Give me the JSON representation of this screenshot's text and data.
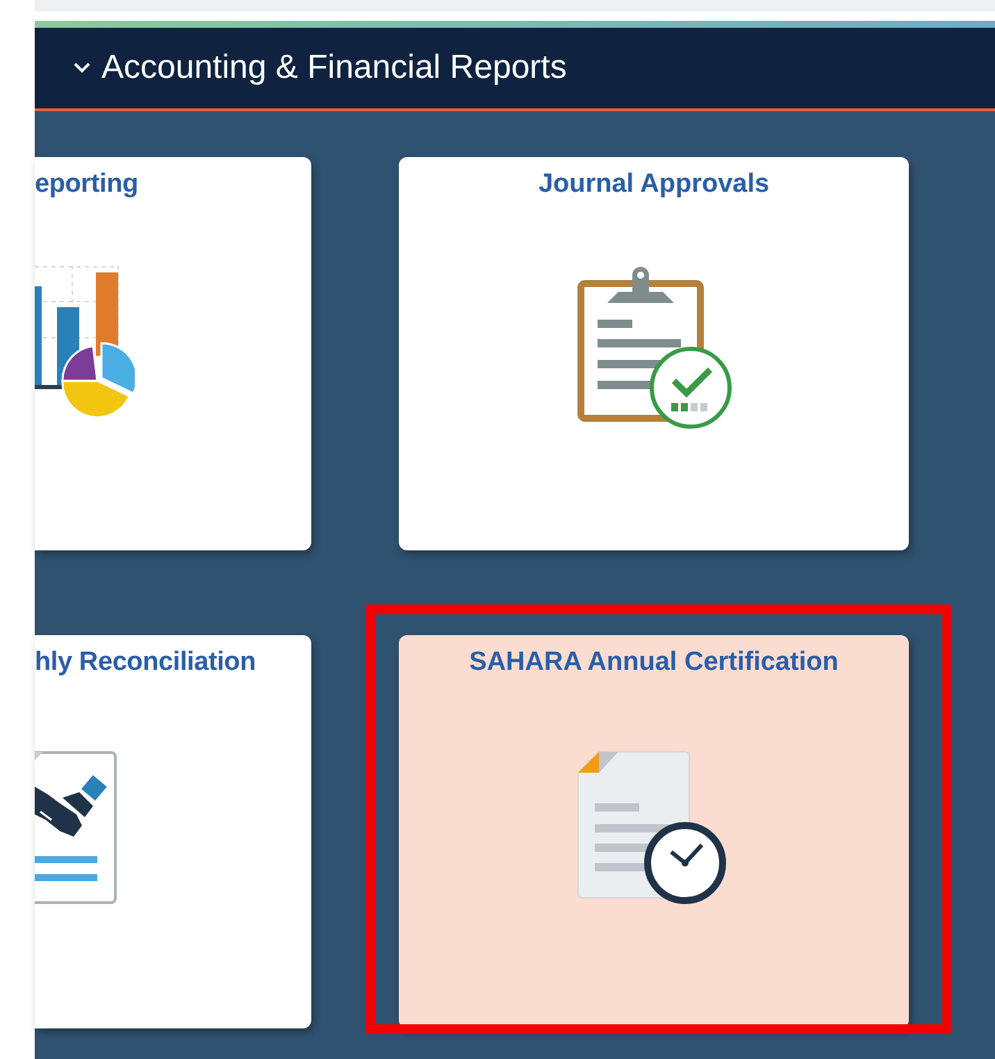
{
  "section": {
    "title": "Accounting & Financial Reports",
    "expanded": true
  },
  "tiles": [
    {
      "title": "eporting",
      "kind": "chart",
      "selected": false,
      "outlined": false
    },
    {
      "title": "Journal Approvals",
      "kind": "clipboard",
      "selected": false,
      "outlined": false
    },
    {
      "title": "hly Reconciliation",
      "kind": "handshake",
      "selected": false,
      "outlined": false
    },
    {
      "title": "SAHARA Annual Certification",
      "kind": "document-clock",
      "selected": true,
      "outlined": true
    }
  ]
}
